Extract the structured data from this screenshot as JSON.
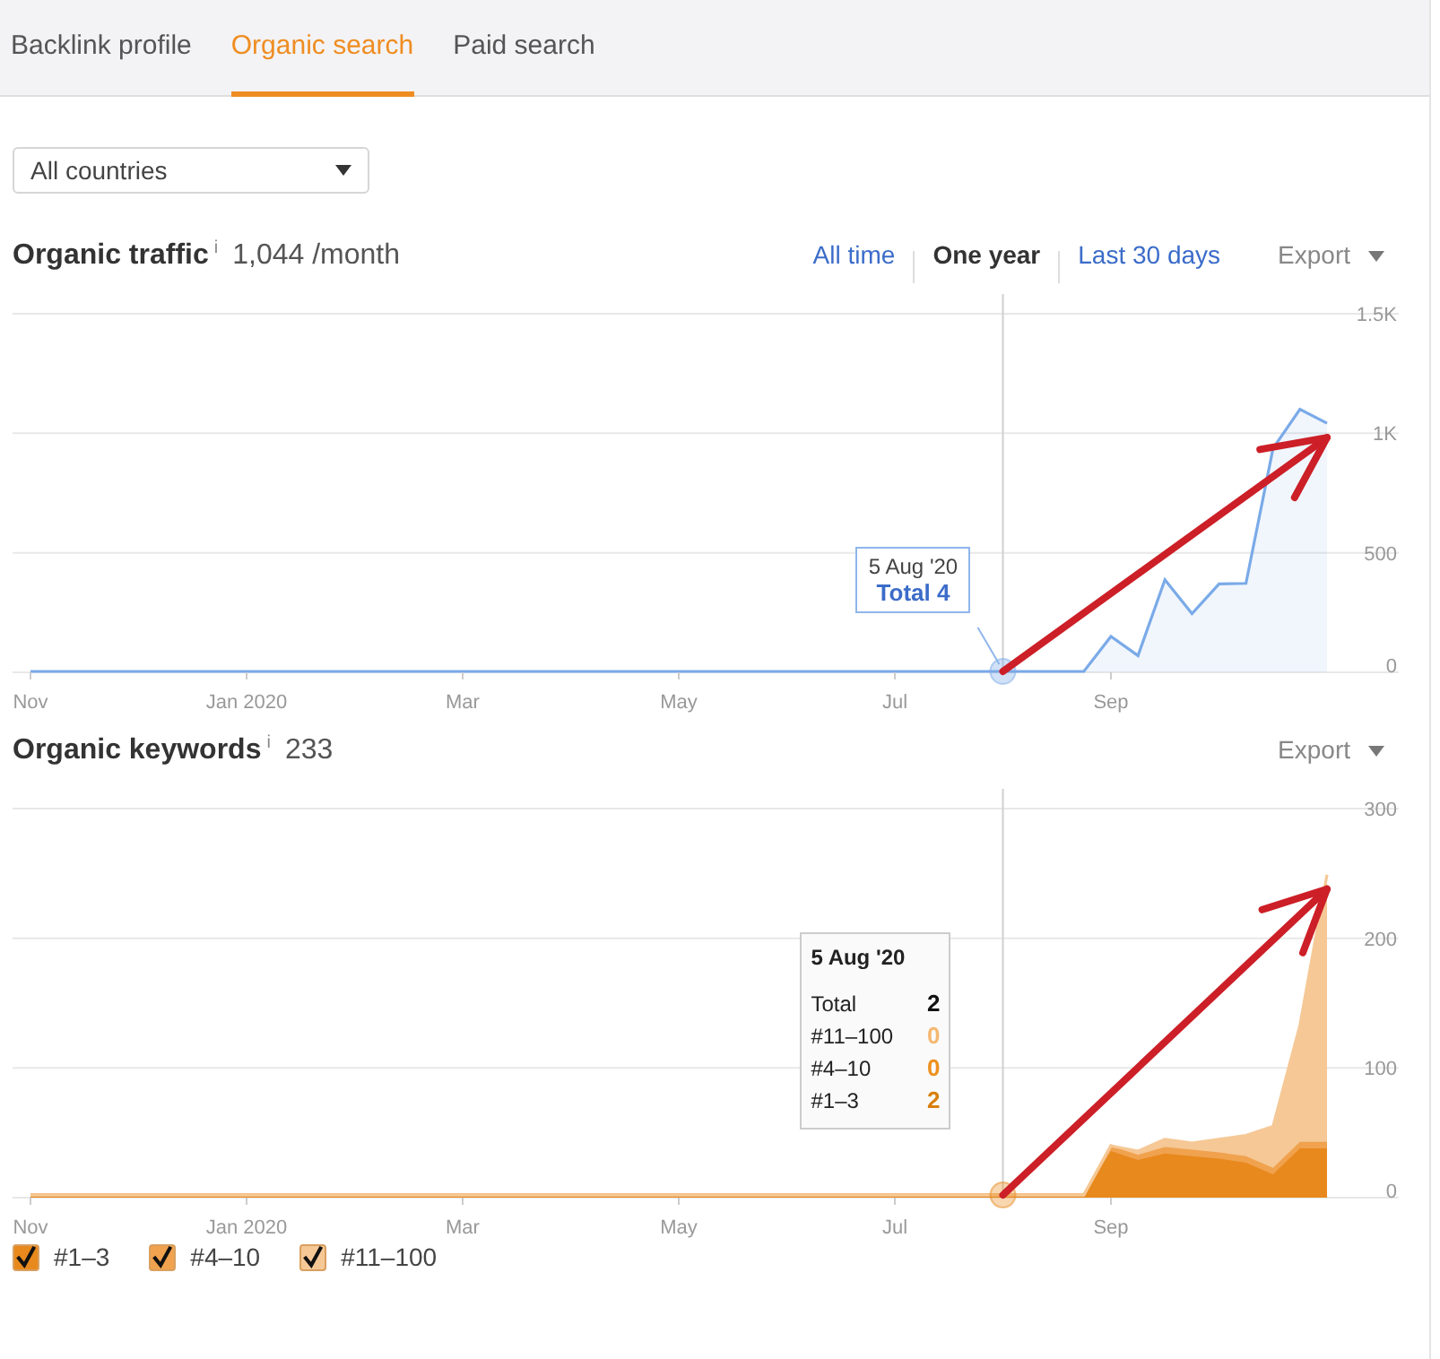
{
  "tabs": [
    {
      "label": "Backlink profile",
      "selected": false
    },
    {
      "label": "Organic search",
      "selected": true
    },
    {
      "label": "Paid search",
      "selected": false
    }
  ],
  "country_select": {
    "value": "All countries"
  },
  "sections": [
    {
      "title": "Organic traffic",
      "info": "i",
      "value": "1,044 /month",
      "ranges": [
        {
          "label": "All time",
          "selected": false
        },
        {
          "label": "One year",
          "selected": true
        },
        {
          "label": "Last 30 days",
          "selected": false
        }
      ],
      "export": "Export",
      "chart_data": {
        "type": "area",
        "categories": [
          "Nov",
          null,
          null,
          null,
          null,
          null,
          null,
          null,
          "Jan 2020",
          null,
          null,
          null,
          null,
          null,
          null,
          null,
          "Mar",
          null,
          null,
          null,
          null,
          null,
          null,
          null,
          "May",
          null,
          null,
          null,
          null,
          null,
          null,
          null,
          "Jul",
          null,
          null,
          null,
          null,
          null,
          null,
          null,
          "Sep",
          null,
          null,
          null,
          null,
          null,
          null,
          null,
          null
        ],
        "series": [
          {
            "name": "Total",
            "color": "#7aaae8",
            "values": [
              4,
              4,
              4,
              4,
              4,
              4,
              4,
              4,
              4,
              4,
              4,
              4,
              4,
              4,
              4,
              4,
              4,
              4,
              4,
              4,
              4,
              4,
              4,
              4,
              4,
              4,
              4,
              4,
              4,
              4,
              4,
              4,
              4,
              4,
              4,
              4,
              4,
              4,
              4,
              4,
              150,
              70,
              387,
              245,
              370,
              372,
              937,
              1100,
              1042
            ]
          }
        ],
        "ylim": [
          0,
          1500
        ],
        "yticks": [
          0,
          500,
          {
            "value": 1000,
            "label": "1K"
          },
          {
            "value": 1500,
            "label": "1.5K"
          }
        ],
        "stacked": false
      },
      "markup": {
        "kind": "arrow"
      },
      "tooltip": {
        "kind": "compact",
        "date": "5 Aug '20",
        "value": "4"
      }
    },
    {
      "title": "Organic keywords",
      "info": "i",
      "value": "233",
      "export": "Export",
      "chart_data": {
        "type": "area",
        "categories": [
          "Nov",
          null,
          null,
          null,
          null,
          null,
          null,
          null,
          "Jan 2020",
          null,
          null,
          null,
          null,
          null,
          null,
          null,
          "Mar",
          null,
          null,
          null,
          null,
          null,
          null,
          null,
          "May",
          null,
          null,
          null,
          null,
          null,
          null,
          null,
          "Jul",
          null,
          null,
          null,
          null,
          null,
          null,
          null,
          "Sep",
          null,
          null,
          null,
          null,
          null,
          null,
          null,
          null
        ],
        "series": [
          {
            "name": "#1–3",
            "color": "#e8891e",
            "values": [
              2,
              2,
              2,
              2,
              2,
              2,
              2,
              2,
              2,
              2,
              2,
              2,
              2,
              2,
              2,
              2,
              2,
              2,
              2,
              2,
              2,
              2,
              2,
              2,
              2,
              2,
              2,
              2,
              2,
              2,
              2,
              2,
              2,
              2,
              2,
              2,
              2,
              2,
              2,
              2,
              36,
              29,
              34,
              32,
              30,
              27,
              18,
              38,
              38
            ]
          },
          {
            "name": "#4–10",
            "color": "#f0a24e",
            "values": [
              0,
              0,
              0,
              0,
              0,
              0,
              0,
              0,
              0,
              0,
              0,
              0,
              0,
              0,
              0,
              0,
              0,
              0,
              0,
              0,
              0,
              0,
              0,
              0,
              0,
              0,
              0,
              0,
              0,
              0,
              0,
              0,
              0,
              0,
              0,
              0,
              0,
              0,
              0,
              0,
              4,
              4,
              5,
              5,
              5,
              5,
              5,
              5,
              5
            ]
          },
          {
            "name": "#11–100",
            "color": "#f5c896",
            "values": [
              0,
              0,
              0,
              0,
              0,
              0,
              0,
              0,
              0,
              0,
              0,
              0,
              0,
              0,
              0,
              0,
              0,
              0,
              0,
              0,
              0,
              0,
              0,
              0,
              0,
              0,
              0,
              0,
              0,
              0,
              0,
              0,
              0,
              0,
              0,
              0,
              0,
              0,
              0,
              0,
              0,
              3,
              6,
              5,
              10,
              16,
              32,
              90,
              206
            ]
          }
        ],
        "ylim": [
          0,
          300
        ],
        "yticks": [
          0,
          100,
          200,
          300
        ],
        "stacked": true
      },
      "markup": {
        "kind": "arrow"
      },
      "tooltip": {
        "kind": "table",
        "date": "5 Aug '20",
        "rows": [
          {
            "label": "Total",
            "value": "2",
            "color": "#111111"
          },
          {
            "label": "#11–100",
            "value": "0",
            "color": "#f5b870"
          },
          {
            "label": "#4–10",
            "value": "0",
            "color": "#ee9020"
          },
          {
            "label": "#1–3",
            "value": "2",
            "color": "#d9800f"
          }
        ]
      },
      "legend": [
        {
          "checked": true
        },
        {
          "checked": true
        },
        {
          "checked": true
        }
      ]
    }
  ]
}
